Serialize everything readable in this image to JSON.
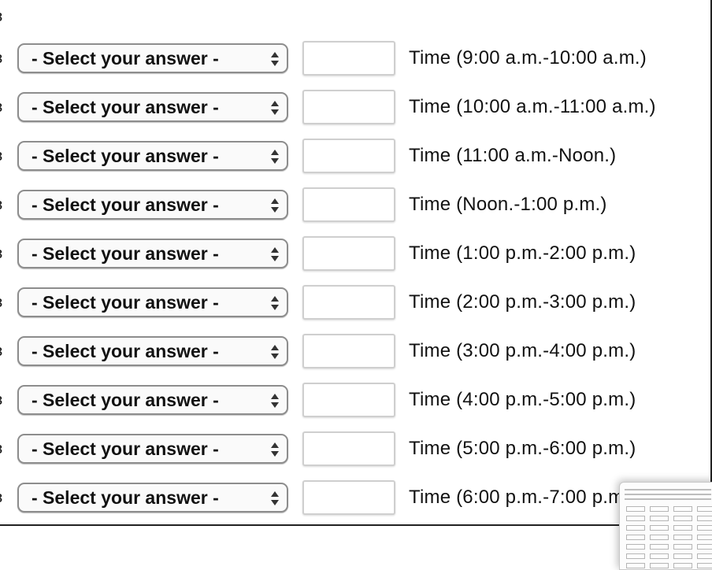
{
  "rows": [
    {
      "select": "- Select your answer -",
      "label": "Time (9:00 a.m.-10:00 a.m.)"
    },
    {
      "select": "- Select your answer -",
      "label": "Time (10:00 a.m.-11:00 a.m.)"
    },
    {
      "select": "- Select your answer -",
      "label": "Time (11:00 a.m.-Noon.)"
    },
    {
      "select": "- Select your answer -",
      "label": "Time (Noon.-1:00 p.m.)"
    },
    {
      "select": "- Select your answer -",
      "label": "Time (1:00 p.m.-2:00 p.m.)"
    },
    {
      "select": "- Select your answer -",
      "label": "Time (2:00 p.m.-3:00 p.m.)"
    },
    {
      "select": "- Select your answer -",
      "label": "Time (3:00 p.m.-4:00 p.m.)"
    },
    {
      "select": "- Select your answer -",
      "label": "Time (4:00 p.m.-5:00 p.m.)"
    },
    {
      "select": "- Select your answer -",
      "label": "Time (5:00 p.m.-6:00 p.m.)"
    },
    {
      "select": "- Select your answer -",
      "label": "Time (6:00 p.m.-7:00 p.m.)"
    }
  ],
  "input_values": [
    "",
    "",
    "",
    "",
    "",
    "",
    "",
    "",
    "",
    ""
  ],
  "icons": {
    "select_arrow": "up-down-arrows-icon",
    "thumbnail": "screenshot-thumbnail"
  },
  "colors": {
    "select_border": "#8d8d8d",
    "box_border": "#cfcfcf",
    "panel_border": "#222222"
  }
}
